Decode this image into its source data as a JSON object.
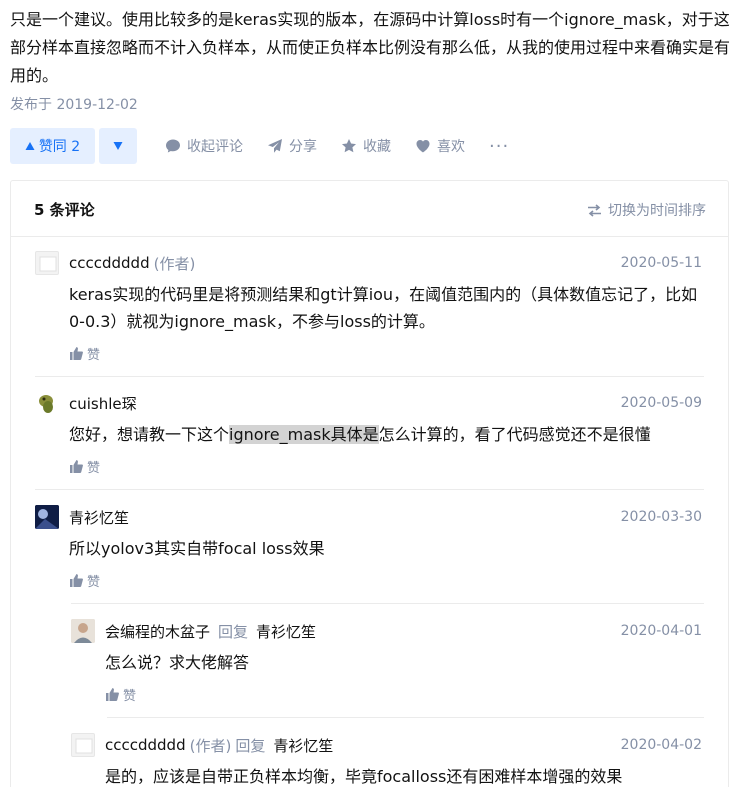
{
  "answer": {
    "text": "只是一个建议。使用比较多的是keras实现的版本，在源码中计算loss时有一个ignore_mask，对于这部分样本直接忽略而不计入负样本，从而使正负样本比例没有那么低，从我的使用过程中来看确实是有用的。",
    "published": "发布于 2019-12-02"
  },
  "actions": {
    "vote_up_label": "赞同 2",
    "collapse_comments": "收起评论",
    "share": "分享",
    "favorite": "收藏",
    "like": "喜欢",
    "more": "···"
  },
  "comments": {
    "count_label": "5 条评论",
    "sort_label": "切换为时间排序",
    "like_label": "赞",
    "items": [
      {
        "author": "ccccddddd",
        "author_tag": "(作者)",
        "date": "2020-05-11",
        "text": "keras实现的代码里是将预测结果和gt计算iou，在阈值范围内的（具体数值忘记了，比如0-0.3）就视为ignore_mask，不参与loss的计算。"
      },
      {
        "author": "cuishle琛",
        "date": "2020-05-09",
        "text_before": "您好，想请教一下这个",
        "text_highlight": "ignore_mask具体是",
        "text_after": "怎么计算的，看了代码感觉还不是很懂"
      },
      {
        "author": "青衫忆笙",
        "date": "2020-03-30",
        "text": "所以yolov3其实自带focal loss效果"
      },
      {
        "author": "会编程的木盆子",
        "reply_word": "回复",
        "reply_to": "青衫忆笙",
        "date": "2020-04-01",
        "text": "怎么说？求大佬解答"
      },
      {
        "author": "ccccddddd",
        "author_tag": "(作者)",
        "reply_word": "回复",
        "reply_to": "青衫忆笙",
        "date": "2020-04-02",
        "text": "是的，应该是自带正负样本均衡，毕竟focalloss还有困难样本增强的效果"
      }
    ]
  },
  "colors": {
    "accent": "#1772f6",
    "accent_bg": "#e5efff",
    "muted": "#8590a6",
    "divider": "#ebebeb"
  }
}
